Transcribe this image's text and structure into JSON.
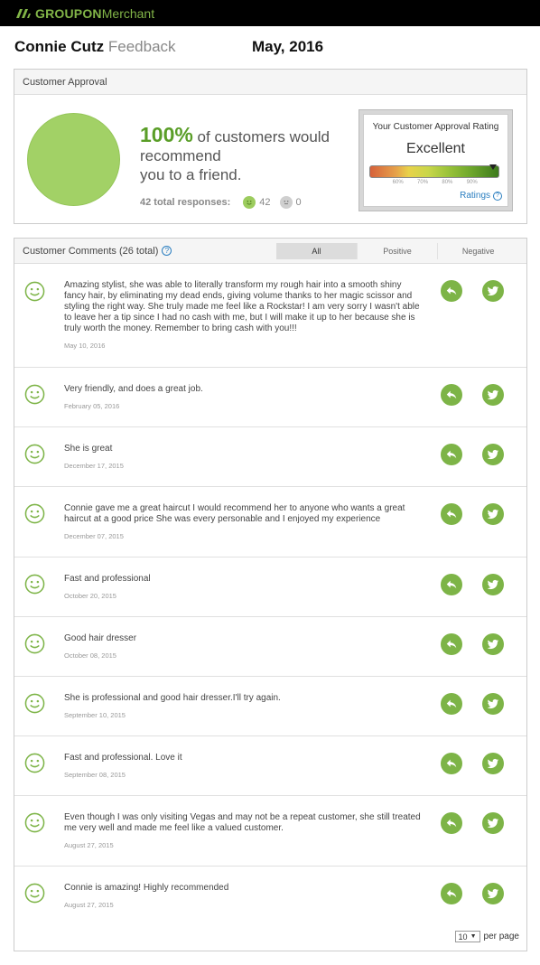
{
  "topbar": {
    "brand": "GROUPON",
    "sub": "Merchant"
  },
  "header": {
    "name": "Connie Cutz",
    "subtitle": "Feedback",
    "date": "May, 2016"
  },
  "approval": {
    "section_title": "Customer Approval",
    "percent": "100%",
    "percent_value": 100,
    "line1": " of customers would",
    "line2": "recommend",
    "line3": "you to a friend.",
    "responses_label": "42 total responses:",
    "positive_count": "42",
    "neutral_count": "0",
    "colors": {
      "circle": "#a2d166",
      "percent": "#5a9e28"
    },
    "rating_card": {
      "title": "Your Customer Approval Rating",
      "value": "Excellent",
      "ticks": [
        "60%",
        "70%",
        "80%",
        "90%"
      ],
      "link": "Ratings"
    }
  },
  "comments": {
    "section_title": "Customer Comments (26 total)",
    "filters": [
      "All",
      "Positive",
      "Negative"
    ],
    "active_filter": "All",
    "items": [
      {
        "text": "Amazing stylist, she was able to literally transform my rough hair into a smooth shiny fancy hair, by eliminating my dead ends, giving volume thanks to her magic scissor and styling the right way. She truly made me feel like a Rockstar! I am very sorry I wasn't able to leave her a tip since I had no cash with me, but I will make it up to her because she is truly worth the money. Remember to bring cash with you!!!",
        "date": "May 10, 2016"
      },
      {
        "text": "Very friendly, and does a great job.",
        "date": "February 05, 2016"
      },
      {
        "text": "She is great",
        "date": "December 17, 2015"
      },
      {
        "text": "Connie gave me a great haircut I would recommend her to anyone who wants a great haircut at a good price She was every personable and I enjoyed my experience",
        "date": "December 07, 2015"
      },
      {
        "text": "Fast and professional",
        "date": "October 20, 2015"
      },
      {
        "text": "Good hair dresser",
        "date": "October 08, 2015"
      },
      {
        "text": "She is professional and good hair dresser.I'll try again.",
        "date": "September 10, 2015"
      },
      {
        "text": "Fast and professional. Love it",
        "date": "September 08, 2015"
      },
      {
        "text": "Even though I was only visiting Vegas and may not be a repeat customer, she still treated me very well and made me feel like a valued customer.",
        "date": "August 27, 2015"
      },
      {
        "text": "Connie is amazing! Highly recommended",
        "date": "August 27, 2015"
      }
    ],
    "per_page_value": "10",
    "per_page_label": "per page",
    "colors": {
      "action": "#7db447",
      "face": "#7db447"
    }
  }
}
